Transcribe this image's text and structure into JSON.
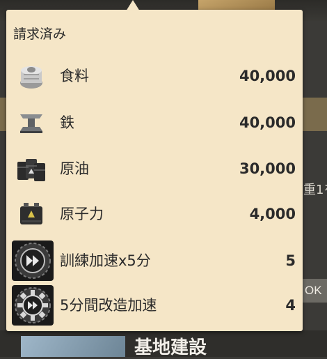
{
  "popup": {
    "title": "請求済み",
    "items": [
      {
        "icon": "food-sack-icon",
        "label": "食料",
        "qty": "40,000"
      },
      {
        "icon": "iron-ingot-icon",
        "label": "鉄",
        "qty": "40,000"
      },
      {
        "icon": "oil-barrels-icon",
        "label": "原油",
        "qty": "30,000"
      },
      {
        "icon": "battery-icon",
        "label": "原子力",
        "qty": "4,000"
      },
      {
        "icon": "training-speedup-icon",
        "label": "訓練加速x5分",
        "qty": "5"
      },
      {
        "icon": "modify-speedup-icon",
        "label": "5分間改造加速",
        "qty": "4"
      }
    ]
  },
  "background": {
    "right_text": "重1を",
    "ok_label": "OK",
    "build_title": "基地建設"
  }
}
